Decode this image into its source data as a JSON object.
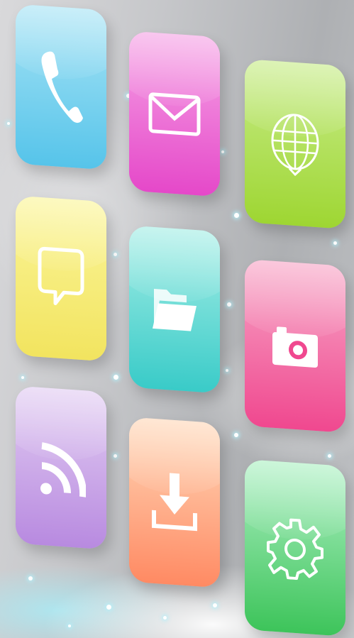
{
  "screen": {
    "apps": [
      {
        "icon": "phone-icon",
        "color": "#56c4ea"
      },
      {
        "icon": "mail-icon",
        "color": "#e548c9"
      },
      {
        "icon": "globe-icon",
        "color": "#9ed632"
      },
      {
        "icon": "chat-bubble-icon",
        "color": "#f2e45f"
      },
      {
        "icon": "folder-icon",
        "color": "#39cbc8"
      },
      {
        "icon": "camera-icon",
        "color": "#f0488f"
      },
      {
        "icon": "rss-icon",
        "color": "#b88ae0"
      },
      {
        "icon": "download-icon",
        "color": "#ff8a63"
      },
      {
        "icon": "gear-icon",
        "color": "#3dc45a"
      }
    ]
  }
}
